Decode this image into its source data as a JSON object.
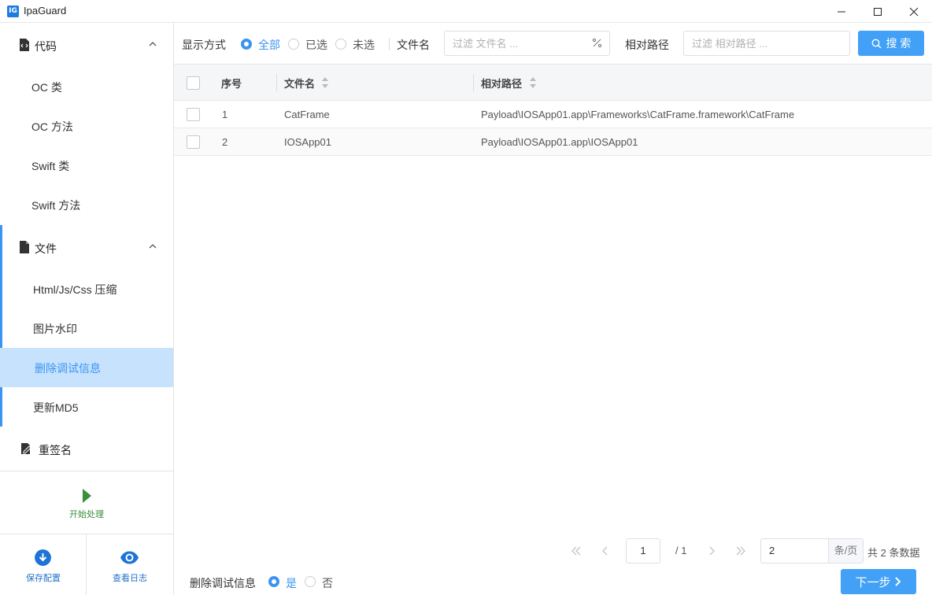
{
  "window": {
    "title": "IpaGuard",
    "icon_text": "IG"
  },
  "sidebar": {
    "groups": [
      {
        "label": "代码",
        "items": [
          "OC 类",
          "OC 方法",
          "Swift 类",
          "Swift 方法"
        ]
      },
      {
        "label": "文件",
        "items": [
          "Html/Js/Css 压缩",
          "图片水印",
          "删除调试信息",
          "更新MD5"
        ]
      },
      {
        "label": "重签名",
        "items": []
      }
    ],
    "active_item": "删除调试信息",
    "start_label": "开始处理",
    "save_label": "保存配置",
    "log_label": "查看日志"
  },
  "toolbar": {
    "display_mode_label": "显示方式",
    "options": [
      "全部",
      "已选",
      "未选"
    ],
    "selected_option": "全部",
    "filename_label": "文件名",
    "filename_placeholder": "过滤 文件名 ...",
    "path_label": "相对路径",
    "path_placeholder": "过滤 相对路径 ...",
    "search_label": "搜 索"
  },
  "table": {
    "columns": [
      "序号",
      "文件名",
      "相对路径"
    ],
    "rows": [
      {
        "index": "1",
        "filename": "CatFrame",
        "path": "Payload\\IOSApp01.app\\Frameworks\\CatFrame.framework\\CatFrame"
      },
      {
        "index": "2",
        "filename": "IOSApp01",
        "path": "Payload\\IOSApp01.app\\IOSApp01"
      }
    ]
  },
  "pagination": {
    "current_page": "1",
    "total_pages": "/ 1",
    "page_size": "2",
    "page_size_unit": "条/页",
    "total_text": "共 2 条数据"
  },
  "footer": {
    "option_label": "删除调试信息",
    "yes": "是",
    "no": "否",
    "selected": "是",
    "next_label": "下一步"
  },
  "colors": {
    "accent": "#3b94f2",
    "button": "#42a1f6",
    "active_bg": "#c6e2fd",
    "start_green": "#3a8f3a"
  }
}
